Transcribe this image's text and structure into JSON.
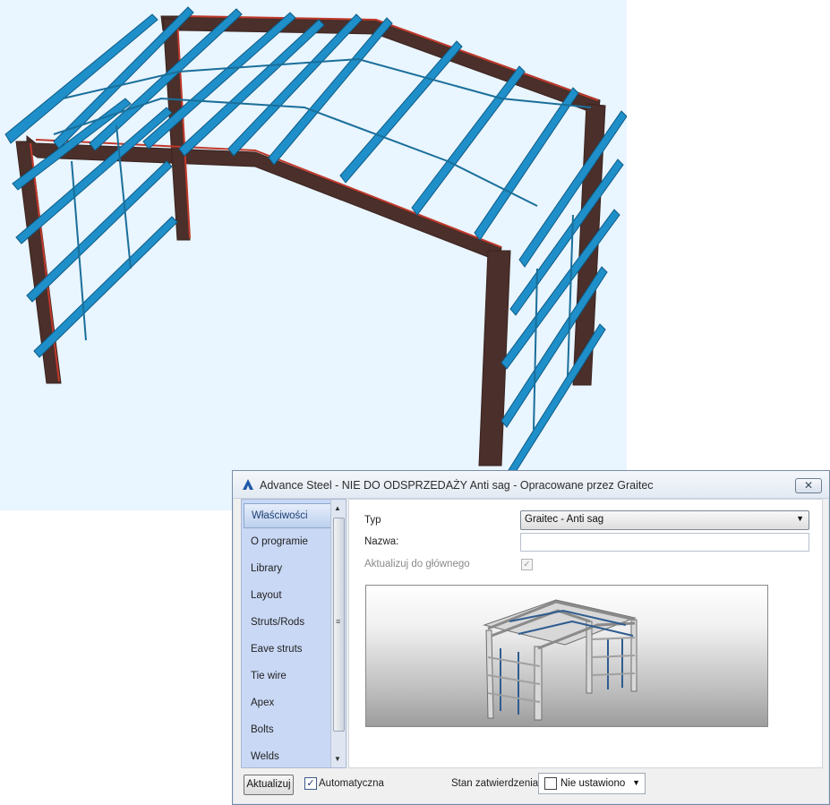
{
  "dialog": {
    "title": "Advance Steel - NIE DO ODSPRZEDAŻY  Anti sag - Opracowane przez Graitec",
    "close_icon": "close-icon"
  },
  "nav": {
    "items": [
      {
        "label": "Właściwości",
        "active": true
      },
      {
        "label": "O programie"
      },
      {
        "label": "Library"
      },
      {
        "label": "Layout"
      },
      {
        "label": "Struts/Rods"
      },
      {
        "label": "Eave struts"
      },
      {
        "label": "Tie wire"
      },
      {
        "label": "Apex"
      },
      {
        "label": "Bolts"
      },
      {
        "label": "Welds"
      }
    ]
  },
  "form": {
    "typ_label": "Typ",
    "typ_value": "Graitec - Anti sag",
    "nazwa_label": "Nazwa:",
    "nazwa_value": "",
    "aktualizuj_label": "Aktualizuj do głównego",
    "aktualizuj_checked": true
  },
  "bottom": {
    "update_button": "Aktualizuj",
    "auto_label": "Automatyczna",
    "auto_checked": true,
    "stan_label": "Stan zatwierdzenia",
    "stan_value": "Nie ustawiono"
  },
  "colors": {
    "purlin": "#1f8fc9",
    "frame": "#4a2f2a",
    "frame_edge": "#c0392b",
    "viewport_bg": "#e9f5ff"
  }
}
